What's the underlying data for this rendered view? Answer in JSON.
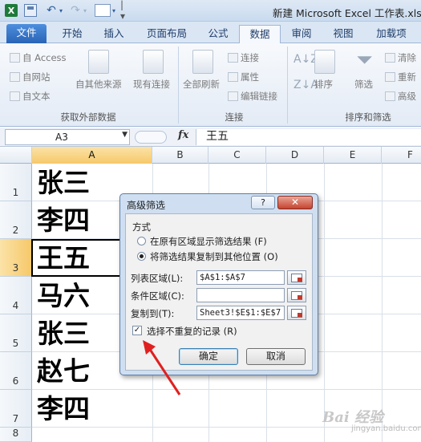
{
  "window": {
    "title": "新建 Microsoft Excel 工作表.xls",
    "icons": [
      "excel-icon",
      "save-icon",
      "undo-icon",
      "redo-icon",
      "form-icon"
    ]
  },
  "tabs": [
    {
      "id": "file",
      "label": "文件"
    },
    {
      "id": "home",
      "label": "开始"
    },
    {
      "id": "insert",
      "label": "插入"
    },
    {
      "id": "layout",
      "label": "页面布局"
    },
    {
      "id": "formulas",
      "label": "公式"
    },
    {
      "id": "data",
      "label": "数据",
      "active": true
    },
    {
      "id": "review",
      "label": "审阅"
    },
    {
      "id": "view",
      "label": "视图"
    },
    {
      "id": "addins",
      "label": "加载项"
    }
  ],
  "ribbon": {
    "external": {
      "access": "自 Access",
      "web": "自网站",
      "text": "自文本",
      "other_sources": "自其他来源",
      "existing": "现有连接",
      "group_label": "获取外部数据"
    },
    "connections": {
      "refresh_all": "全部刷新",
      "connections": "连接",
      "properties": "属性",
      "edit_links": "编辑链接",
      "group_label": "连接"
    },
    "sort_filter": {
      "sort": "排序",
      "filter": "筛选",
      "clear": "清除",
      "reapply": "重新",
      "advanced": "高级",
      "group_label": "排序和筛选"
    }
  },
  "formula_bar": {
    "name_box": "A3",
    "fx": "fx",
    "content": "王五"
  },
  "grid": {
    "columns": [
      "A",
      "B",
      "C",
      "D",
      "E",
      "F"
    ],
    "rows": [
      "1",
      "2",
      "3",
      "4",
      "5",
      "6",
      "7",
      "8"
    ],
    "column_a_values": [
      "张三",
      "李四",
      "王五",
      "马六",
      "张三",
      "赵七",
      "李四",
      ""
    ],
    "active_cell": "A3"
  },
  "dialog": {
    "title": "高级筛选",
    "help": "?",
    "close": "✕",
    "method_label": "方式",
    "option_in_place": "在原有区域显示筛选结果 (F)",
    "option_copy": "将筛选结果复制到其他位置 (O)",
    "option_selected": "copy",
    "list_range_label": "列表区域(L):",
    "list_range_value": "$A$1:$A$7",
    "criteria_range_label": "条件区域(C):",
    "criteria_range_value": "",
    "copy_to_label": "复制到(T):",
    "copy_to_value": "Sheet3!$E$1:$E$7",
    "unique_label": "选择不重复的记录 (R)",
    "unique_checked": true,
    "ok": "确定",
    "cancel": "取消"
  },
  "annotation": {
    "arrow_color": "#e02020"
  },
  "watermark": {
    "text": "Bai 经验",
    "sub": "jingyan.baidu.com"
  }
}
